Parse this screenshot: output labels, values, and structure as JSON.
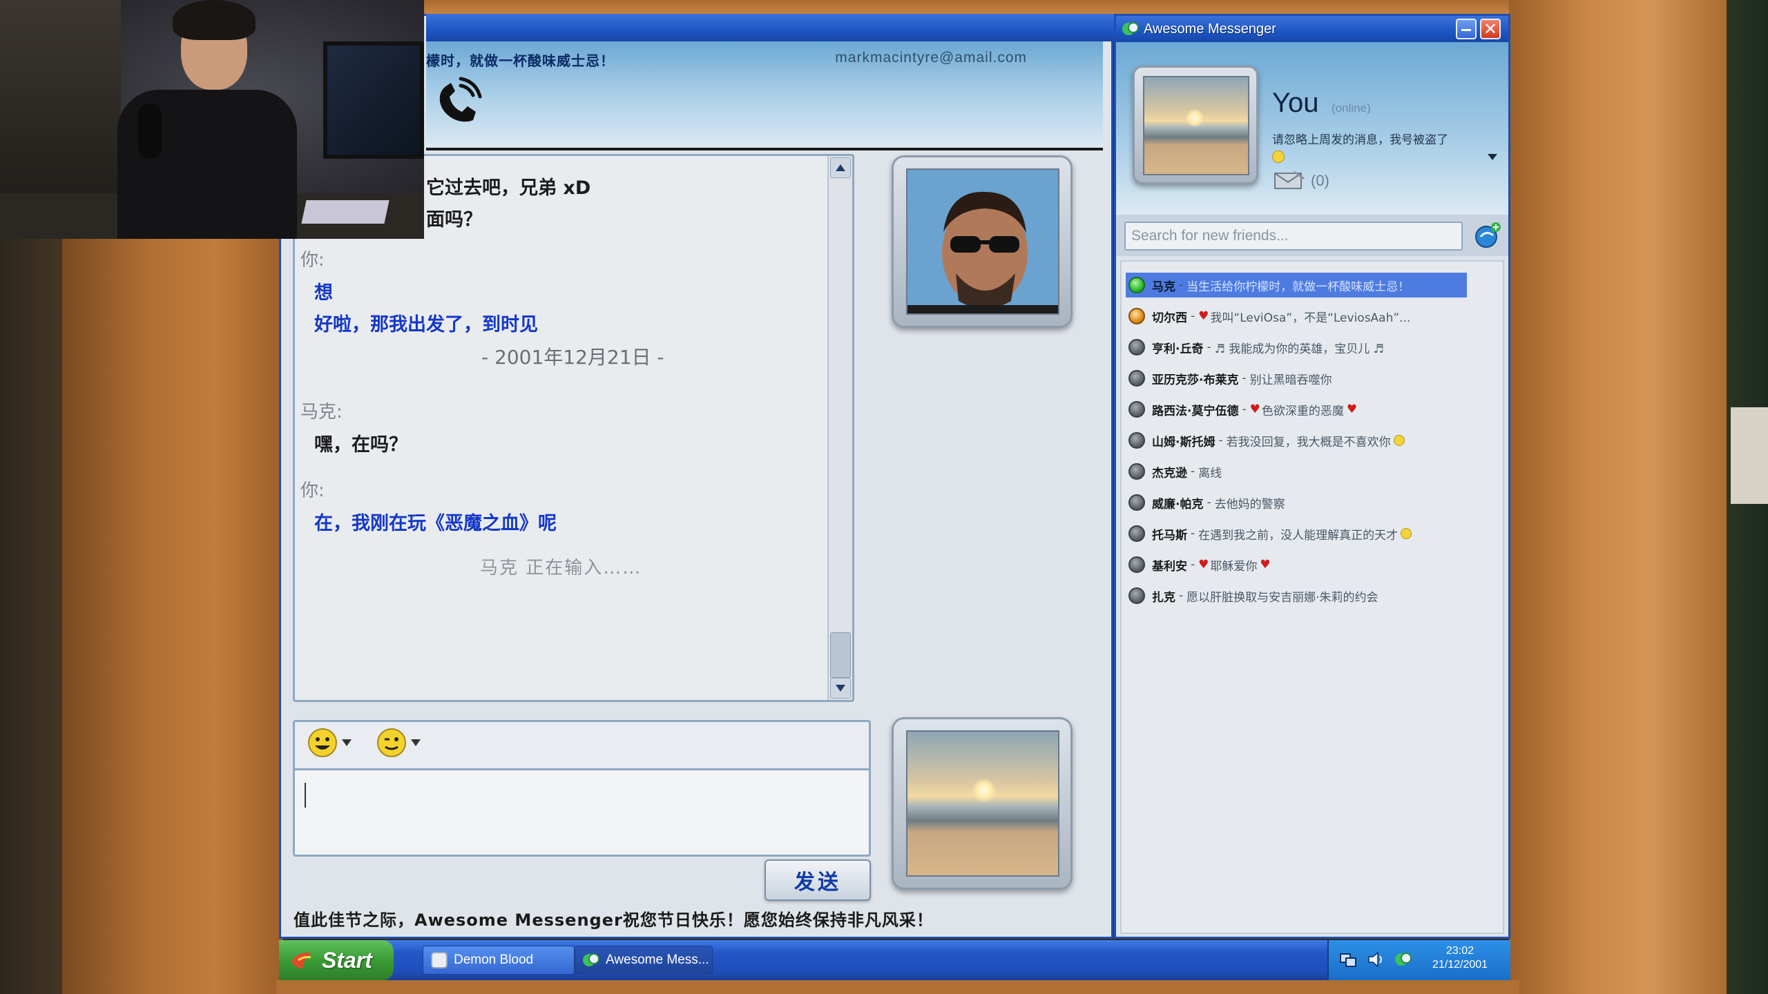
{
  "chat": {
    "status_ticker": "檬时，就做一杯酸味威士忌！",
    "contact_email": "markmacintyre@amail.com",
    "messages": [
      {
        "kind": "mark",
        "text": "它过去吧，兄弟 xD"
      },
      {
        "kind": "mark",
        "text": "面吗？"
      },
      {
        "kind": "sender",
        "text": "你:"
      },
      {
        "kind": "you",
        "text": "想"
      },
      {
        "kind": "you",
        "text": "好啦，那我出发了，到时见"
      },
      {
        "kind": "date",
        "text": "- 2001年12月21日 -"
      },
      {
        "kind": "sender",
        "text": "马克:"
      },
      {
        "kind": "mark",
        "text": "嘿，在吗？"
      },
      {
        "kind": "sender",
        "text": "你:"
      },
      {
        "kind": "you",
        "text": "在，我刚在玩《恶魔之血》呢"
      }
    ],
    "typing_indicator": "马克 正在输入……",
    "send_label": "发送",
    "promo": "值此佳节之际，Awesome Messenger祝您节日快乐！愿您始终保持非凡风采！"
  },
  "contacts": {
    "app_title": "Awesome Messenger",
    "close_glyph": "✕",
    "profile": {
      "name": "You",
      "status": "(online)",
      "message": "请忽略上周发的消息，我号被盗了",
      "mail_count": "(0)"
    },
    "search_placeholder": "Search for new friends...",
    "friends": [
      {
        "name": "马克",
        "status": "online",
        "message": "当生活给你柠檬时，就做一杯酸味威士忌！",
        "selected": true
      },
      {
        "name": "切尔西",
        "status": "away",
        "message": "我叫“LeviOsa”，不是“LeviosAah”...",
        "heart_before": true
      },
      {
        "name": "亨利·丘奇",
        "status": "offline",
        "message": "♬ 我能成为你的英雄，宝贝儿 ♬"
      },
      {
        "name": "亚历克莎·布莱克",
        "status": "offline",
        "message": "别让黑暗吞噬你"
      },
      {
        "name": "路西法·莫宁伍德",
        "status": "offline",
        "message": "色欲深重的恶魔",
        "heart_before": true,
        "heart_after": true
      },
      {
        "name": "山姆·斯托姆",
        "status": "offline",
        "message": "若我没回复，我大概是不喜欢你",
        "face_after": true
      },
      {
        "name": "杰克逊",
        "status": "offline",
        "message": "离线"
      },
      {
        "name": "威廉·帕克",
        "status": "offline",
        "message": "去他妈的警察"
      },
      {
        "name": "托马斯",
        "status": "offline",
        "message": "在遇到我之前，没人能理解真正的天才",
        "face_after": true
      },
      {
        "name": "基利安",
        "status": "offline",
        "message": "耶稣爱你",
        "heart_before": true,
        "heart_after": true
      },
      {
        "name": "扎克",
        "status": "offline",
        "message": "愿以肝脏换取与安吉丽娜·朱莉的约会"
      }
    ]
  },
  "taskbar": {
    "start_label": "Start",
    "tasks": [
      {
        "label": "Demon Blood"
      },
      {
        "label": "Awesome Mess..."
      }
    ],
    "clock_time": "23:02",
    "clock_date": "21/12/2001"
  },
  "colors": {
    "titlebar": "#1d56c4",
    "you_text": "#1437c9",
    "selected_row": "#4d7be0",
    "start_green": "#3a9c35"
  }
}
